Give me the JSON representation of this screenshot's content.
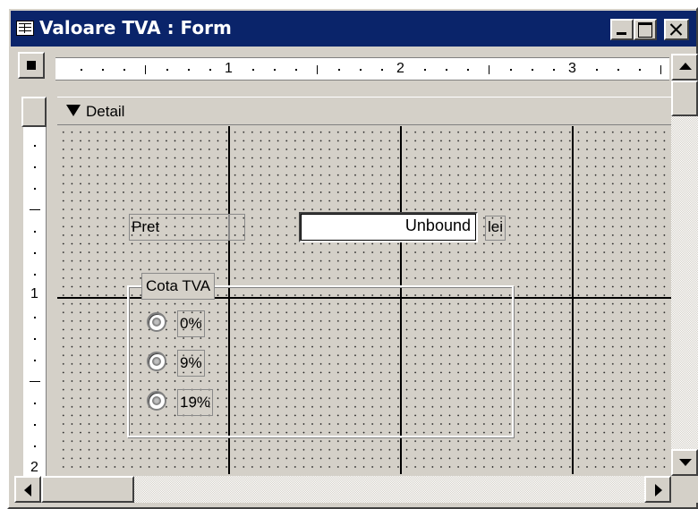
{
  "window": {
    "title": "Valoare TVA : Form",
    "title_bar_color": "#0a246a"
  },
  "ruler": {
    "horizontal_numbers": [
      "1",
      "2",
      "3"
    ],
    "vertical_numbers": [
      "1",
      "2"
    ]
  },
  "section": {
    "label": "Detail"
  },
  "form": {
    "pret_label": "Pret",
    "pret_textbox_value": "Unbound",
    "unit_label": "lei",
    "option_group_label": "Cota TVA",
    "options": [
      {
        "label": "0%"
      },
      {
        "label": "9%"
      },
      {
        "label": "19%"
      }
    ]
  },
  "icons": {
    "window_icon": "form-icon",
    "minimize": "minimize-icon",
    "maximize": "maximize-icon",
    "close": "close-icon",
    "section_selector": "arrow-down-icon"
  }
}
